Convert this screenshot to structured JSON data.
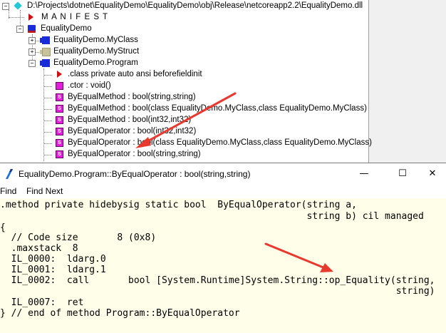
{
  "tree": {
    "root_path": "D:\\Projects\\dotnet\\EqualityDemo\\EqualityDemo\\obj\\Release\\netcoreapp2.2\\EqualityDemo.dll",
    "manifest": "M A N I F E S T",
    "namespace": "EqualityDemo",
    "classes": [
      {
        "label": "EqualityDemo.MyClass",
        "icon": "class-icon"
      },
      {
        "label": "EqualityDemo.MyStruct",
        "icon": "struct-icon"
      },
      {
        "label": "EqualityDemo.Program",
        "icon": "class-icon"
      }
    ],
    "members": [
      {
        "label": ".class private auto ansi beforefieldinit",
        "icon": "class-info-icon"
      },
      {
        "label": ".ctor : void()",
        "icon": "method-icon"
      },
      {
        "label": "ByEqualMethod : bool(string,string)",
        "icon": "static-method-icon"
      },
      {
        "label": "ByEqualMethod : bool(class EqualityDemo.MyClass,class EqualityDemo.MyClass)",
        "icon": "static-method-icon"
      },
      {
        "label": "ByEqualMethod : bool(int32,int32)",
        "icon": "static-method-icon"
      },
      {
        "label": "ByEqualOperator : bool(int32,int32)",
        "icon": "static-method-icon"
      },
      {
        "label": "ByEqualOperator : bool(class EqualityDemo.MyClass,class EqualityDemo.MyClass)",
        "icon": "static-method-icon"
      },
      {
        "label": "ByEqualOperator : bool(string,string)",
        "icon": "static-method-icon"
      }
    ]
  },
  "window": {
    "title": "EqualityDemo.Program::ByEqualOperator : bool(string,string)",
    "minimize": "—",
    "maximize": "☐",
    "close": "✕"
  },
  "menu": {
    "find": "Find",
    "find_next": "Find Next"
  },
  "code": {
    "lines": [
      ".method private hidebysig static bool  ByEqualOperator(string a,",
      "                                                       string b) cil managed",
      "{",
      "  // Code size       8 (0x8)",
      "  .maxstack  8",
      "  IL_0000:  ldarg.0",
      "  IL_0001:  ldarg.1",
      "  IL_0002:  call       bool [System.Runtime]System.String::op_Equality(string,",
      "                                                                       string)",
      "  IL_0007:  ret",
      "} // end of method Program::ByEqualOperator"
    ]
  },
  "colors": {
    "annotation_arrow": "#e8392f",
    "code_background": "#fffee8"
  }
}
